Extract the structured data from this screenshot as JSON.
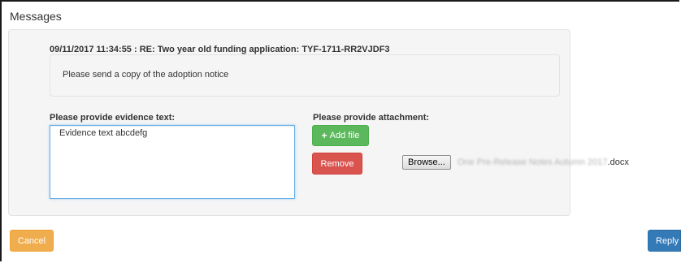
{
  "title": "Messages",
  "message": {
    "header": "09/11/2017 11:34:55 : RE: Two year old funding application: TYF-1711-RR2VJDF3",
    "body": "Please send a copy of the adoption notice"
  },
  "evidence": {
    "label": "Please provide evidence text:",
    "value": "Evidence text abcdefg"
  },
  "attachment": {
    "label": "Please provide attachment:",
    "add_file_label": "Add file",
    "add_icon": "plus-icon",
    "remove_label": "Remove",
    "browse_label": "Browse...",
    "file_name_blurred": "One Pre-Release Notes Autumn 2017",
    "file_name_ext": ".docx"
  },
  "footer": {
    "cancel_label": "Cancel",
    "reply_label": "Reply"
  },
  "colors": {
    "success": "#5cb85c",
    "danger": "#d9534f",
    "warning": "#f0ad4e",
    "primary": "#337ab7",
    "panel_bg": "#f5f5f5"
  }
}
